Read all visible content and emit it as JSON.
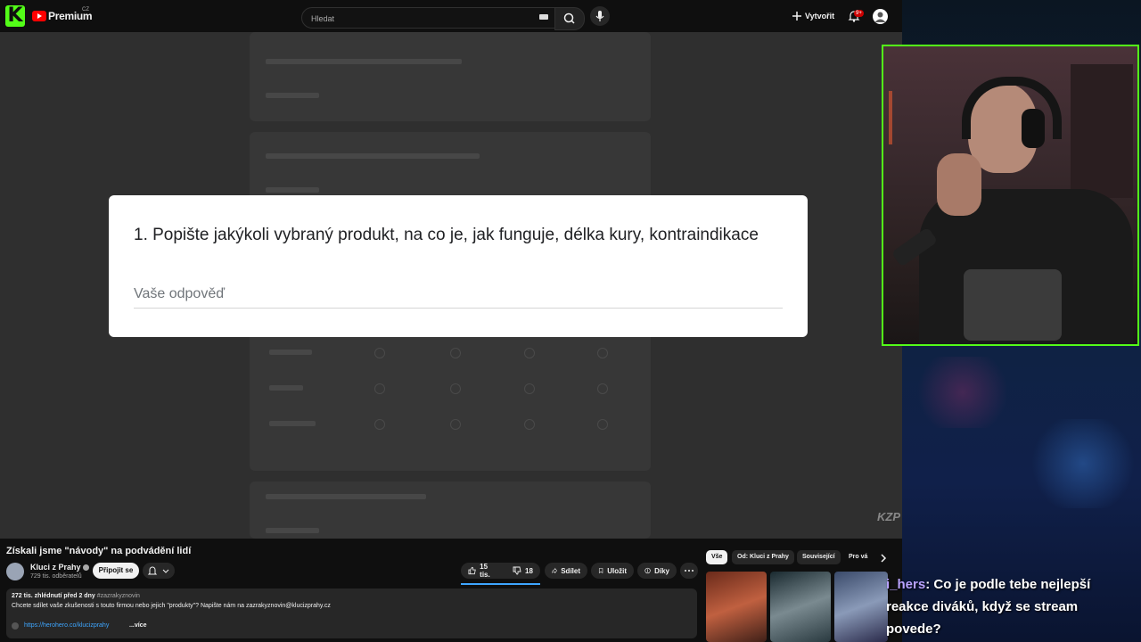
{
  "header": {
    "brand": "Premium",
    "country": "CZ",
    "search_placeholder": "Hledat",
    "create_label": "Vytvořit",
    "notifications_badge": "9+"
  },
  "form": {
    "question": "1. Popište jakýkoli vybraný produkt, na co je, jak funguje, délka kury, kontraindikace",
    "answer_placeholder": "Vaše odpověď"
  },
  "watermark": "KZP",
  "video": {
    "title": "Získali jsme \"návody\" na podvádění lidí",
    "channel_name": "Kluci z Prahy",
    "subscribers": "729 tis. odběratelů",
    "join_label": "Připojit se",
    "likes": "15 tis.",
    "dislikes": "18",
    "share_label": "Sdílet",
    "save_label": "Uložit",
    "thanks_label": "Díky",
    "meta": "272 tis. zhlédnutí  před 2 dny",
    "hashtag": "#zazrakyznovin",
    "description": "Chcete sdílet vaše zkušenosti s touto firmou nebo jejich \"produkty\"? Napište nám na zazrakyznovin@klucizprahy.cz",
    "link": "https://herohero.co/klucizprahy",
    "more_label": "...více"
  },
  "related": {
    "chips": [
      "Vše",
      "Od: Kluci z Prahy",
      "Související",
      "Pro vá"
    ]
  },
  "stream": {
    "chat_user": "i_hers",
    "chat_text": ": Co je podle tebe nejlepší reakce diváků, když se stream povede?"
  },
  "colors": {
    "kick_green": "#53fc18",
    "youtube_red": "#ff0000",
    "link_blue": "#3ea6ff"
  }
}
